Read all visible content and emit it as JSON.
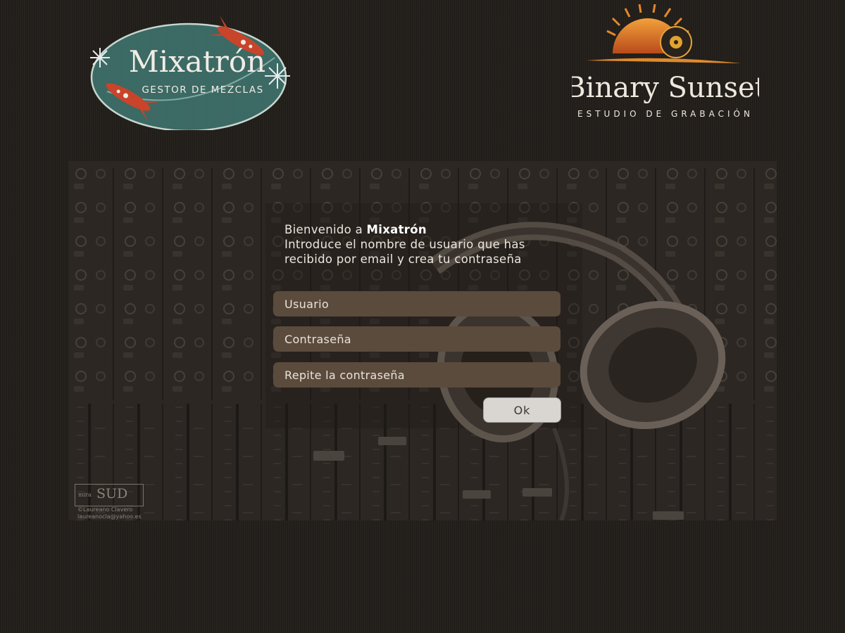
{
  "logos": {
    "mixatron": {
      "name": "Mixatrón",
      "tagline": "GESTOR DE MEZCLAS"
    },
    "binary_sunset": {
      "name": "Binary Sunset",
      "tagline": "ESTUDIO DE GRABACIÓN"
    }
  },
  "welcome": {
    "greeting_prefix": "Bienvenido a ",
    "app_name": "Mixatrón",
    "line2": "Introduce el nombre de usuario que has",
    "line3": "recibido por email y crea tu contraseña"
  },
  "form": {
    "username_placeholder": "Usuario",
    "password_placeholder": "Contraseña",
    "password_repeat_placeholder": "Repite la contraseña",
    "submit_label": "Ok"
  },
  "watermark": {
    "mark_small": "mira",
    "mark_big": "SUD",
    "credit_line1": "©Laureano Clavero",
    "credit_line2": "laureanocla@yahoo.es"
  },
  "colors": {
    "page_bg": "#26221e",
    "field_bg": "#5b4b3d",
    "button_bg": "#d9d6d2",
    "mixatron_badge": "#3e6e68",
    "rocket_red": "#c8442b",
    "sunset_orange": "#e08a2c"
  }
}
